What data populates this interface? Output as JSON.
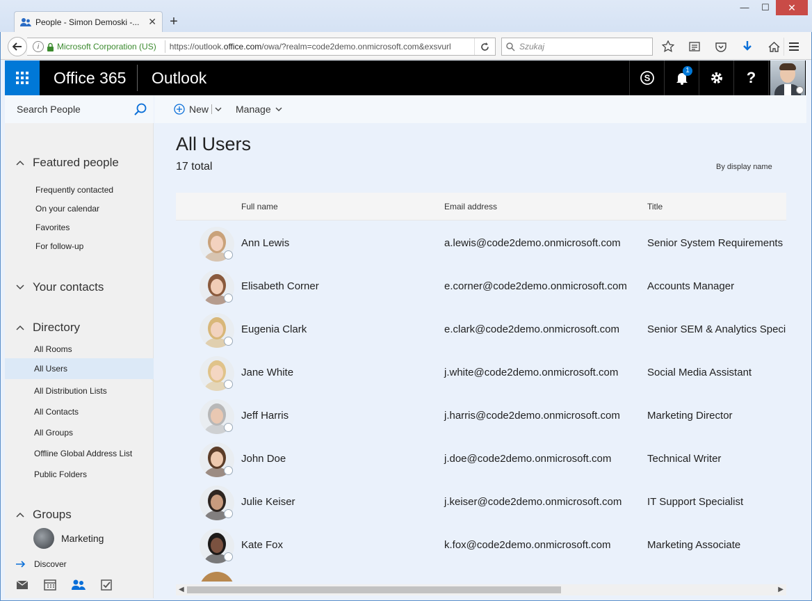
{
  "browser": {
    "tab_title": "People - Simon Demoski -...",
    "site_identity": "Microsoft Corporation (US)",
    "url_prefix": "https://outlook.",
    "url_domain": "office.com",
    "url_rest": "/owa/?realm=code2demo.onmicrosoft.com&exsvurl",
    "search_placeholder": "Szukaj",
    "accent": "#0078d7"
  },
  "header": {
    "brand": "Office 365",
    "app": "Outlook",
    "notification_count": "1"
  },
  "left_nav": {
    "search_label": "Search People",
    "featured_heading": "Featured people",
    "featured_items": [
      "Frequently contacted",
      "On your calendar",
      "Favorites",
      "For follow-up"
    ],
    "contacts_heading": "Your contacts",
    "directory_heading": "Directory",
    "directory_items": [
      "All Rooms",
      "All Users",
      "All Distribution Lists",
      "All Contacts",
      "All Groups",
      "Offline Global Address List",
      "Public Folders"
    ],
    "selected_directory_item": "All Users",
    "groups_heading": "Groups",
    "group_name": "Marketing",
    "discover": "Discover"
  },
  "command_bar": {
    "new_label": "New",
    "manage_label": "Manage"
  },
  "main": {
    "title": "All Users",
    "total": "17 total",
    "sort_label": "By display name",
    "columns": {
      "full_name": "Full name",
      "email": "Email address",
      "title": "Title"
    },
    "rows": [
      {
        "name": "Ann Lewis",
        "email": "a.lewis@code2demo.onmicrosoft.com",
        "title": "Senior System Requirements",
        "hair": "#c9a27a",
        "skin": "#f3d2bf"
      },
      {
        "name": "Elisabeth Corner",
        "email": "e.corner@code2demo.onmicrosoft.com",
        "title": "Accounts Manager",
        "hair": "#8a5a3c",
        "skin": "#f1cdb6"
      },
      {
        "name": "Eugenia Clark",
        "email": "e.clark@code2demo.onmicrosoft.com",
        "title": "Senior SEM & Analytics Speci",
        "hair": "#d8b779",
        "skin": "#f2d3bf"
      },
      {
        "name": "Jane White",
        "email": "j.white@code2demo.onmicrosoft.com",
        "title": "Social Media Assistant",
        "hair": "#e0c38a",
        "skin": "#f4d6c2"
      },
      {
        "name": "Jeff Harris",
        "email": "j.harris@code2demo.onmicrosoft.com",
        "title": "Marketing Director",
        "hair": "#b8b8b8",
        "skin": "#e9c8b2"
      },
      {
        "name": "John Doe",
        "email": "j.doe@code2demo.onmicrosoft.com",
        "title": "Technical Writer",
        "hair": "#5c3d28",
        "skin": "#eec9ae"
      },
      {
        "name": "Julie Keiser",
        "email": "j.keiser@code2demo.onmicrosoft.com",
        "title": "IT Support Specialist",
        "hair": "#2e2520",
        "skin": "#c89b7e"
      },
      {
        "name": "Kate Fox",
        "email": "k.fox@code2demo.onmicrosoft.com",
        "title": "Marketing Associate",
        "hair": "#1d1a18",
        "skin": "#7b5240"
      }
    ]
  }
}
